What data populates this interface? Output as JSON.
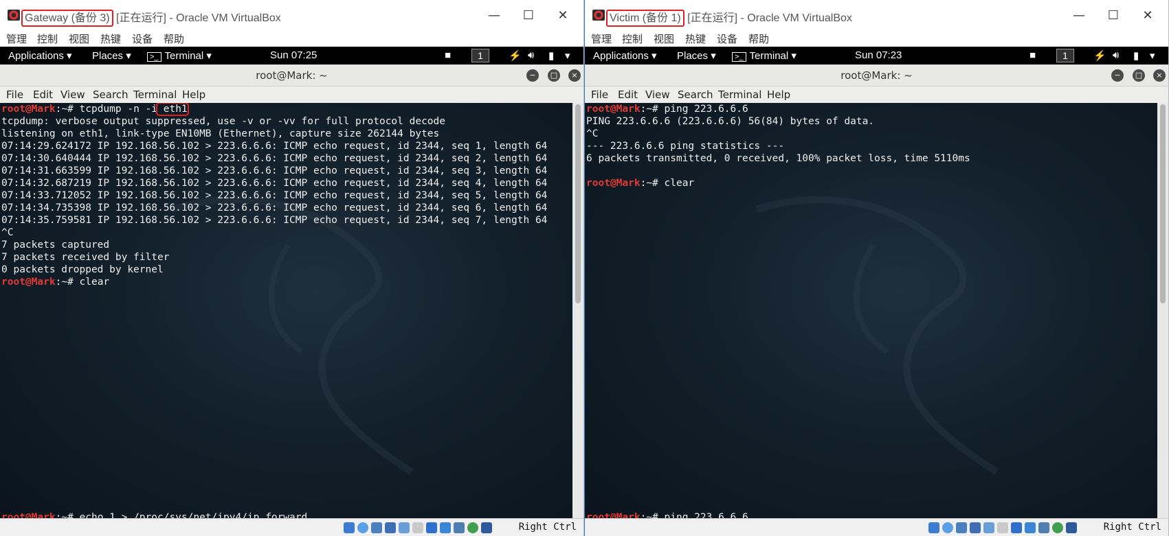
{
  "left_vm": {
    "window_title_highlight": "Gateway (备份 3)",
    "window_title_rest": "[正在运行] - Oracle VM VirtualBox",
    "menu": [
      "管理",
      "控制",
      "视图",
      "热键",
      "设备",
      "帮助"
    ],
    "gnome": {
      "applications": "Applications ▾",
      "places": "Places ▾",
      "terminal": "Terminal ▾",
      "clock": "Sun 07:25",
      "workspace": "1"
    },
    "term_title": "root@Mark: ~",
    "term_menu": [
      "File",
      "Edit",
      "View",
      "Search",
      "Terminal",
      "Help"
    ],
    "prompt_user": "root@Mark",
    "prompt_suffix": ":~# ",
    "cmd1_pre": "tcpdump -n -i",
    "cmd1_hl": " eth1",
    "output": [
      "tcpdump: verbose output suppressed, use -v or -vv for full protocol decode",
      "listening on eth1, link-type EN10MB (Ethernet), capture size 262144 bytes",
      "07:14:29.624172 IP 192.168.56.102 > 223.6.6.6: ICMP echo request, id 2344, seq 1, length 64",
      "07:14:30.640444 IP 192.168.56.102 > 223.6.6.6: ICMP echo request, id 2344, seq 2, length 64",
      "07:14:31.663599 IP 192.168.56.102 > 223.6.6.6: ICMP echo request, id 2344, seq 3, length 64",
      "07:14:32.687219 IP 192.168.56.102 > 223.6.6.6: ICMP echo request, id 2344, seq 4, length 64",
      "07:14:33.712052 IP 192.168.56.102 > 223.6.6.6: ICMP echo request, id 2344, seq 5, length 64",
      "07:14:34.735398 IP 192.168.56.102 > 223.6.6.6: ICMP echo request, id 2344, seq 6, length 64",
      "07:14:35.759581 IP 192.168.56.102 > 223.6.6.6: ICMP echo request, id 2344, seq 7, length 64",
      "^C",
      "7 packets captured",
      "7 packets received by filter",
      "0 packets dropped by kernel"
    ],
    "cmd2": "clear",
    "bottom_cmd": "echo 1 > /proc/sys/net/ipv4/ip_forward",
    "host_key": "Right Ctrl"
  },
  "right_vm": {
    "window_title_highlight": "Victim (备份 1)",
    "window_title_rest": "[正在运行] - Oracle VM VirtualBox",
    "menu": [
      "管理",
      "控制",
      "视图",
      "热键",
      "设备",
      "帮助"
    ],
    "gnome": {
      "applications": "Applications ▾",
      "places": "Places ▾",
      "terminal": "Terminal ▾",
      "clock": "Sun 07:23",
      "workspace": "1"
    },
    "term_title": "root@Mark: ~",
    "term_menu": [
      "File",
      "Edit",
      "View",
      "Search",
      "Terminal",
      "Help"
    ],
    "prompt_user": "root@Mark",
    "prompt_suffix": ":~# ",
    "cmd1": "ping 223.6.6.6",
    "output": [
      "PING 223.6.6.6 (223.6.6.6) 56(84) bytes of data.",
      "^C",
      "--- 223.6.6.6 ping statistics ---",
      "6 packets transmitted, 0 received, 100% packet loss, time 5110ms",
      ""
    ],
    "cmd2": "clear",
    "bottom_cmd": "ping 223.6.6.6",
    "host_key": "Right Ctrl"
  },
  "colors": {
    "prompt": "#e53935",
    "highlight_box": "#e02020",
    "gnome_bar": "#000000"
  }
}
